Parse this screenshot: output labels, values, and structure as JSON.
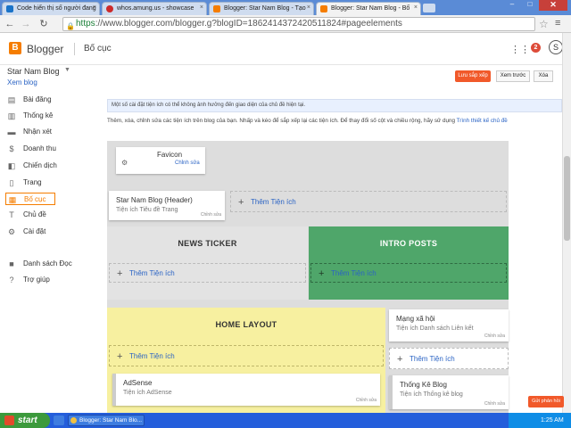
{
  "browser": {
    "tabs": [
      {
        "label": "Code hiển thị số người đang",
        "favicon_color": "#1a73c8"
      },
      {
        "label": "whos.amung.us - showcase",
        "favicon_color": "#cc2a2a"
      },
      {
        "label": "Blogger: Star Nam Blog - Tạo",
        "favicon_color": "#f57d00"
      },
      {
        "label": "Blogger: Star Nam Blog - Bố",
        "favicon_color": "#f57d00"
      }
    ],
    "tab_close": "×",
    "new_tab": "",
    "window_controls": {
      "minimize": "–",
      "maximize": "□",
      "close": "✕"
    },
    "nav": {
      "back": "←",
      "forward": "→",
      "reload": "↻"
    },
    "url_scheme": "https",
    "url_rest": "://www.blogger.com/blogger.g?blogID=1862414372420511824#pageelements",
    "star": "☆",
    "menu": "≡"
  },
  "header": {
    "logo_letter": "B",
    "brand": "Blogger",
    "title": "Bố cục",
    "apps_icon": "⋮⋮",
    "notification_count": "2",
    "avatar_letter": "S"
  },
  "sidebar": {
    "blog_name": "Star Nam Blog",
    "caret": "▼",
    "view_blog": "Xem blog",
    "items": [
      {
        "label": "Bài đăng",
        "icon": "▤",
        "icon_name": "posts-icon"
      },
      {
        "label": "Thống kê",
        "icon": "▥",
        "icon_name": "stats-icon"
      },
      {
        "label": "Nhận xét",
        "icon": "▬",
        "icon_name": "comments-icon"
      },
      {
        "label": "Doanh thu",
        "icon": "$",
        "icon_name": "earnings-icon"
      },
      {
        "label": "Chiến dịch",
        "icon": "◧",
        "icon_name": "campaigns-icon"
      },
      {
        "label": "Trang",
        "icon": "▯",
        "icon_name": "pages-icon"
      },
      {
        "label": "Bố cục",
        "icon": "▦",
        "icon_name": "layout-icon",
        "active": true
      },
      {
        "label": "Chủ đề",
        "icon": "T",
        "icon_name": "theme-icon"
      },
      {
        "label": "Cài đặt",
        "icon": "⚙",
        "icon_name": "settings-icon"
      },
      {
        "label": "Danh sách Đọc",
        "icon": "■",
        "icon_name": "reading-list-icon"
      },
      {
        "label": "Trợ giúp",
        "icon": "?",
        "icon_name": "help-icon"
      }
    ]
  },
  "main": {
    "save_button": "Lưu sắp xếp",
    "preview_button": "Xem trước",
    "clear_button": "Xóa",
    "notice": "Một số cài đặt tiện ích có thể không ảnh hưởng đến giao diện của chủ đề hiện tại.",
    "description": "Thêm, xóa, chỉnh sửa các tiện ích trên blog của bạn. Nhấp và kéo để sắp xếp lại các tiện ích. Để thay đổi số cột và chiều rộng, hãy sử dụng",
    "description_link": "Trình thiết kế chủ đề",
    "edit_label": "Chỉnh sửa",
    "add_widget_label": "Thêm Tiện ích",
    "plus": "+",
    "favicon_widget": {
      "title": "Favicon",
      "edit": "Chỉnh sửa"
    },
    "header_widget": {
      "title": "Star Nam Blog (Header)",
      "subtitle": "Tiện ích Tiêu đề Trang"
    },
    "news_ticker": {
      "title": "NEWS TICKER",
      "color": "#e3e3e3"
    },
    "intro_posts": {
      "title": "INTRO POSTS",
      "color": "#4fa66a"
    },
    "home_layout": {
      "title": "HOME LAYOUT",
      "color": "#f7f0a0"
    },
    "social_widget": {
      "title": "Mạng xã hội",
      "subtitle": "Tiện ích Danh sách Liên kết"
    },
    "adsense_widget": {
      "title": "AdSense",
      "subtitle": "Tiện ích AdSense"
    },
    "stats_widget": {
      "title": "Thống Kê Blog",
      "subtitle": "Tiện ích Thống kê blog"
    },
    "feedback_button": "Gửi phản hồi"
  },
  "taskbar": {
    "start": "start",
    "active_window": "Blogger: Star Nam Blo...",
    "clock": "1:25 AM"
  }
}
